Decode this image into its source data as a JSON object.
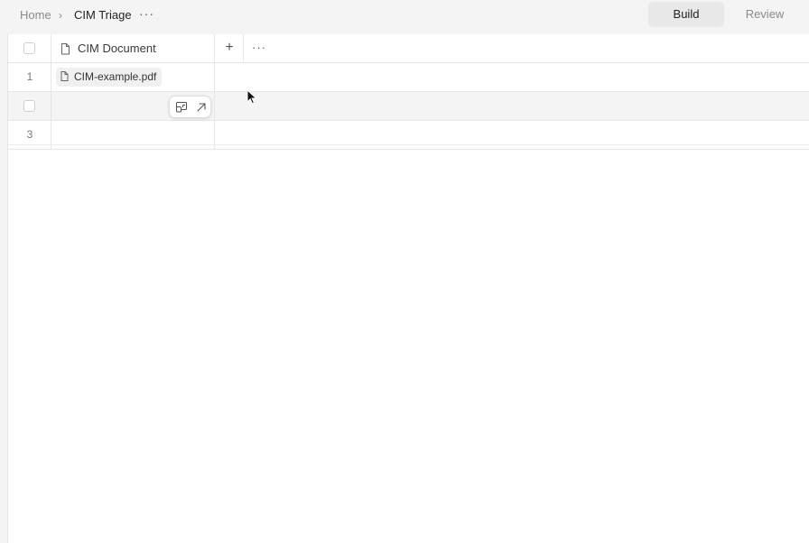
{
  "breadcrumb": {
    "home": "Home",
    "separator": "›",
    "title": "CIM Triage",
    "more": "···"
  },
  "modes": {
    "build": "Build",
    "review": "Review",
    "active": "Build"
  },
  "table": {
    "column_header": "CIM Document",
    "add_column": "+",
    "more": "···",
    "rows": [
      {
        "number": "1",
        "document": "CIM-example.pdf"
      },
      {
        "number": "",
        "document": ""
      },
      {
        "number": "3",
        "document": ""
      }
    ]
  },
  "icons": {
    "file": "file-icon",
    "expand": "expand-row-icon",
    "open": "open-arrow-icon",
    "more": "more-dots-icon",
    "add": "plus-icon"
  },
  "colors": {
    "background": "#f4f4f4",
    "sheet": "#ffffff",
    "active_mode": "#e8e8e8"
  }
}
